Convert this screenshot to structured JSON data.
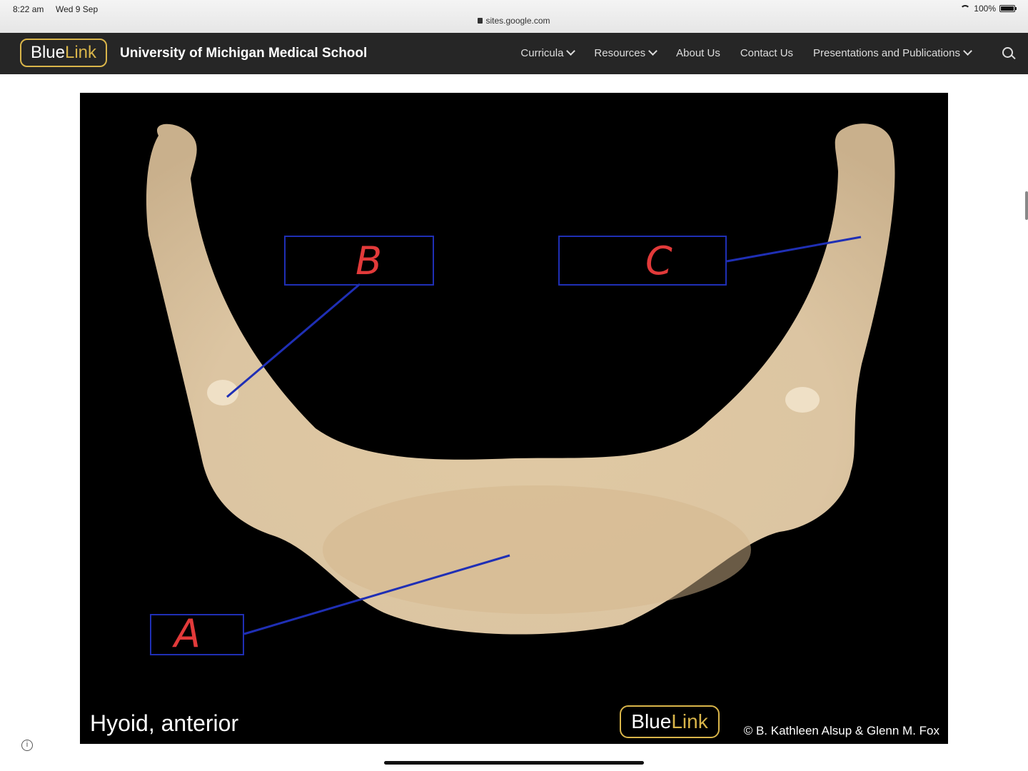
{
  "status": {
    "time": "8:22 am",
    "date": "Wed 9 Sep",
    "battery": "100%",
    "url": "sites.google.com"
  },
  "header": {
    "logo_blue": "Blue",
    "logo_link": "Link",
    "school": "University of Michigan Medical School",
    "nav": {
      "curricula": "Curricula",
      "resources": "Resources",
      "about": "About Us",
      "contact": "Contact Us",
      "presentations": "Presentations and Publications"
    }
  },
  "figure": {
    "caption": "Hyoid, anterior",
    "labels": {
      "a": "A",
      "b": "B",
      "c": "C"
    },
    "logo_blue": "Blue",
    "logo_link": "Link",
    "copyright": "© B. Kathleen Alsup & Glenn M. Fox",
    "colors": {
      "bone": "#e3cfb0",
      "box": "#1f2fb5",
      "letter": "#e23a3a"
    }
  }
}
